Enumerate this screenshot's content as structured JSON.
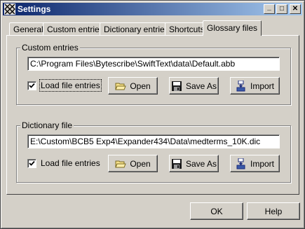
{
  "window": {
    "title": "Settings"
  },
  "titlebar": {
    "minimize_glyph": "_",
    "maximize_glyph": "□",
    "close_glyph": "✕"
  },
  "tabs": [
    {
      "label": "General"
    },
    {
      "label": "Custom entries"
    },
    {
      "label": "Dictionary entries"
    },
    {
      "label": "Shortcuts"
    },
    {
      "label": "Glossary files",
      "active": true
    }
  ],
  "custom_entries": {
    "legend": "Custom entries",
    "path": "C:\\Program Files\\Bytescribe\\SwiftText\\data\\Default.abb",
    "load_label": "Load file entries",
    "load_checked": true,
    "open_label": "Open",
    "saveas_label": "Save As",
    "import_label": "Import"
  },
  "dictionary_file": {
    "legend": "Dictionary file",
    "path": "E:\\Custom\\BCB5 Exp4\\Expander434\\Data\\medterms_10K.dic",
    "load_label": "Load file entries",
    "load_checked": true,
    "open_label": "Open",
    "saveas_label": "Save As",
    "import_label": "Import"
  },
  "footer": {
    "ok_label": "OK",
    "help_label": "Help"
  },
  "icons": {
    "open": "folder-icon",
    "saveas": "floppy-disk-icon",
    "import": "import-icon"
  }
}
